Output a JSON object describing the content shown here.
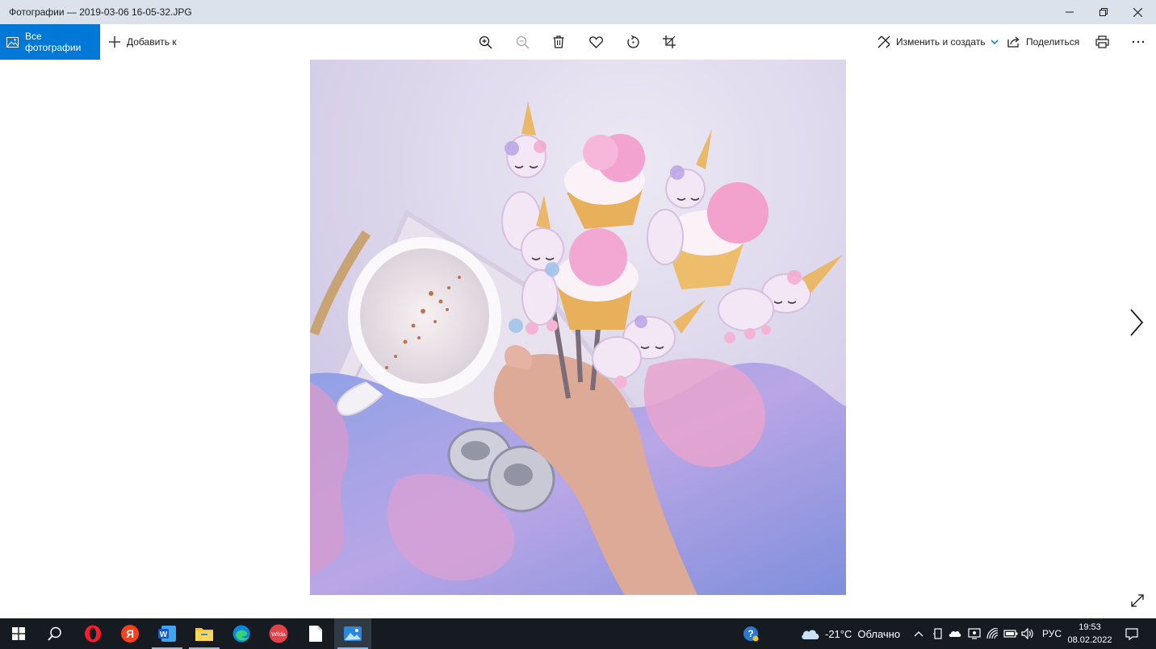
{
  "window": {
    "title": "Фотографии — 2019-03-06 16-05-32.JPG"
  },
  "toolbar": {
    "all_photos_label": "Все фотографии",
    "add_to_label": "Добавить к",
    "edit_create_label": "Изменить и создать",
    "share_label": "Поделиться"
  },
  "taskbar": {
    "apps": [
      "start-icon",
      "search-icon",
      "opera-icon",
      "yandex-icon",
      "word-icon",
      "file-explorer-icon",
      "edge-icon",
      "wilda-icon",
      "notepad-icon",
      "photos-icon"
    ],
    "yandex_letter": "Я",
    "word_letter": "W",
    "wilda_label": "Wilda",
    "weather_temp": "-21°C",
    "weather_text": "Облачно",
    "language": "РУС",
    "time": "19:53",
    "date": "08.02.2022"
  },
  "colors": {
    "accent": "#0078d7",
    "titlebar_bg": "#dbe2ec",
    "taskbar_bg": "#151b20"
  }
}
